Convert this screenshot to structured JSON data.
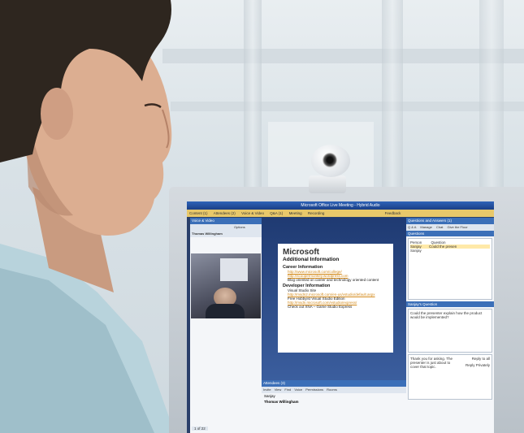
{
  "window": {
    "title": "Microsoft Office Live Meeting - Hybrid Audio",
    "menu": [
      "Content (1)",
      "Attendees (2)",
      "Voice & Video",
      "Q&A (1)",
      "Meeting",
      "Recording"
    ],
    "feedback_label": "Feedback"
  },
  "voice_video": {
    "header": "Voice & Video",
    "speaker": "Thomas Willingham",
    "options_label": "Options"
  },
  "slide": {
    "brand": "Microsoft",
    "subtitle": "Additional Information",
    "sections": [
      {
        "heading": "Career Information",
        "lines": [
          {
            "kind": "link",
            "text": "http://www.microsoft.com/college/"
          },
          {
            "kind": "link",
            "text": "http://scoopermonkey.wordpress.com"
          },
          {
            "kind": "text",
            "text": "Blog oriented on career and technology oriented content"
          }
        ]
      },
      {
        "heading": "Developer Information",
        "lines": [
          {
            "kind": "text",
            "text": "Visual Studio Site"
          },
          {
            "kind": "link",
            "text": "http://msdn2.microsoft.com/en-us/vstudio/default.aspx"
          },
          {
            "kind": "text",
            "text": "Free Hobbyist Visual Studio Edition"
          },
          {
            "kind": "link",
            "text": "http://msdn.microsoft.com/vstudio/express/"
          },
          {
            "kind": "text",
            "text": "Check out XNA – Game Studio Express"
          }
        ]
      }
    ]
  },
  "attendees": {
    "header": "Attendees (3)",
    "toolbar": [
      "Invite",
      "View",
      "Find",
      "Voice",
      "Permissions",
      "Rooms"
    ],
    "names": [
      "Sanjay",
      "Thomas Willingham"
    ]
  },
  "qa": {
    "header": "Questions and Answers (1)",
    "tabs": [
      "Q & A",
      "Manage"
    ],
    "subtabs": [
      "Chat",
      "Give the Floor"
    ],
    "questions_label": "Questions",
    "columns": [
      "Person",
      "Question"
    ],
    "rows": [
      {
        "person": "Sanjay",
        "question": "Could the presen"
      },
      {
        "person": "Sanjay",
        "question": ""
      }
    ],
    "selected_header": "Sanjay's Question",
    "selected_text": "Could the presenter explain how the product would be implemented?",
    "reply_text": "Thank you for asking. The presenter is just about to cover that topic.",
    "reply_all_label": "Reply to all",
    "reply_private_label": "Reply Privately"
  },
  "status": {
    "page": "1 of 22"
  }
}
